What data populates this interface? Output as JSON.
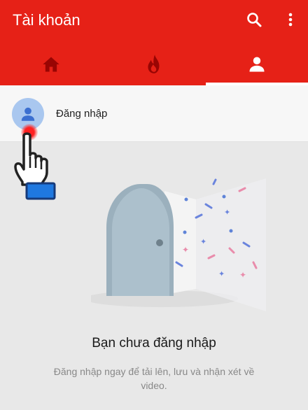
{
  "app_bar": {
    "title": "Tài khoản",
    "color": "#e62117",
    "actions": [
      {
        "icon": "search-icon"
      },
      {
        "icon": "more-vertical-icon"
      }
    ]
  },
  "tabs": [
    {
      "icon": "home-icon",
      "selected": false
    },
    {
      "icon": "trending-flame-icon",
      "selected": false
    },
    {
      "icon": "account-icon",
      "selected": true
    }
  ],
  "account_row": {
    "label": "Đăng nhập",
    "avatar_icon": "person-icon",
    "avatar_color": "#a9c7ef"
  },
  "empty_state": {
    "title": "Bạn chưa đăng nhập",
    "description": "Đăng nhập ngay để tải lên, lưu và nhận xét về video."
  }
}
